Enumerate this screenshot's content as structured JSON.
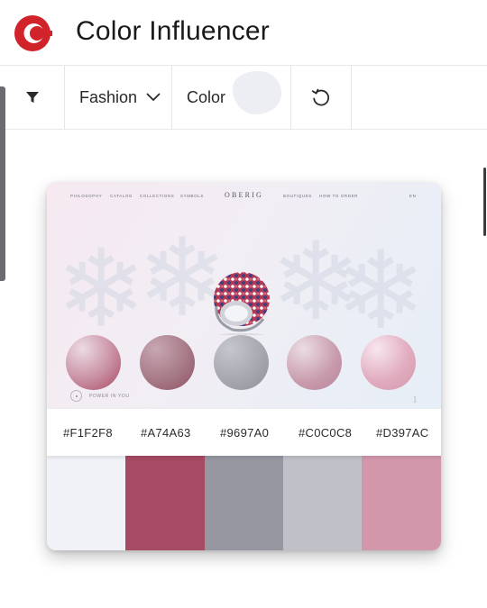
{
  "app": {
    "title": "Color Influencer",
    "logo_icon": "color-influencer-c-logo",
    "brand_color": "#d1232a"
  },
  "toolbar": {
    "filter_icon": "filter-icon",
    "category": "Fashion",
    "category_icon": "chevron-down-icon",
    "color_label": "Color",
    "selected_color": "#edeef3",
    "reset_icon": "reset-icon"
  },
  "preview": {
    "nav_left": [
      "PHILOSOPHY",
      "CATALOG",
      "COLLECTIONS",
      "SYMBOLS"
    ],
    "logo": "OBERIG",
    "nav_right": [
      "BOUTIQUES",
      "HOW TO ORDER"
    ],
    "lang": "EN ·",
    "tagline": "POWER IN YOU",
    "page_number": "1"
  },
  "palette": [
    {
      "hex": "#F1F2F8",
      "color": "#F1F2F8"
    },
    {
      "hex": "#A74A63",
      "color": "#A74A63"
    },
    {
      "hex": "#9697A0",
      "color": "#9697A0"
    },
    {
      "hex": "#C0C0C8",
      "color": "#C0C0C8"
    },
    {
      "hex": "#D397AC",
      "color": "#D397AC"
    }
  ]
}
